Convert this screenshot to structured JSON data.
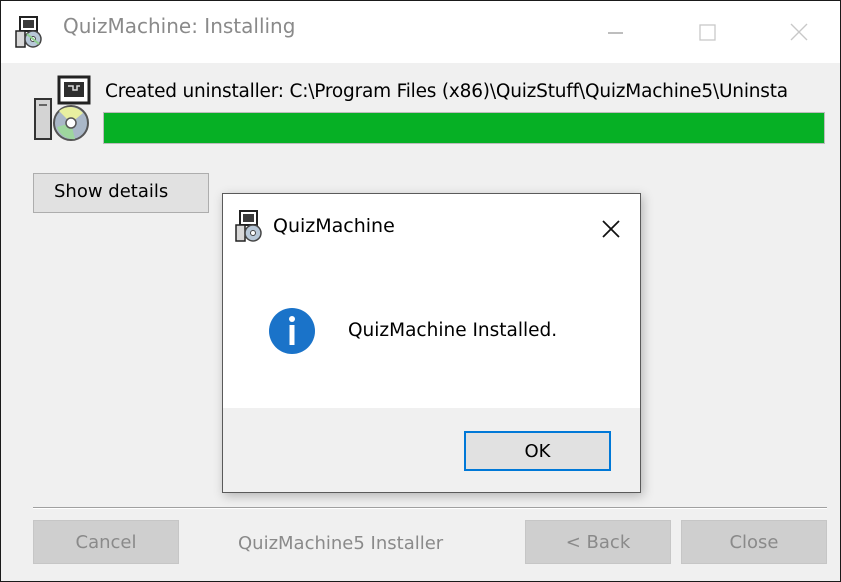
{
  "window": {
    "title": "QuizMachine: Installing",
    "status_text": "Created uninstaller: C:\\Program Files (x86)\\QuizStuff\\QuizMachine5\\Uninsta",
    "progress_percent": 100,
    "progress_color": "#06b025",
    "show_details_label": "Show details",
    "branding_text": "QuizMachine5 Installer",
    "buttons": {
      "cancel": "Cancel",
      "back": "< Back",
      "close": "Close"
    },
    "title_buttons": [
      "minimize-icon",
      "maximize-icon",
      "close-icon"
    ]
  },
  "dialog": {
    "title": "QuizMachine",
    "message": "QuizMachine Installed.",
    "icon": "info-icon",
    "icon_color": "#1a73c9",
    "ok_label": "OK"
  },
  "colors": {
    "accent": "#0078d7",
    "disabled_text": "#8a8a8a"
  }
}
